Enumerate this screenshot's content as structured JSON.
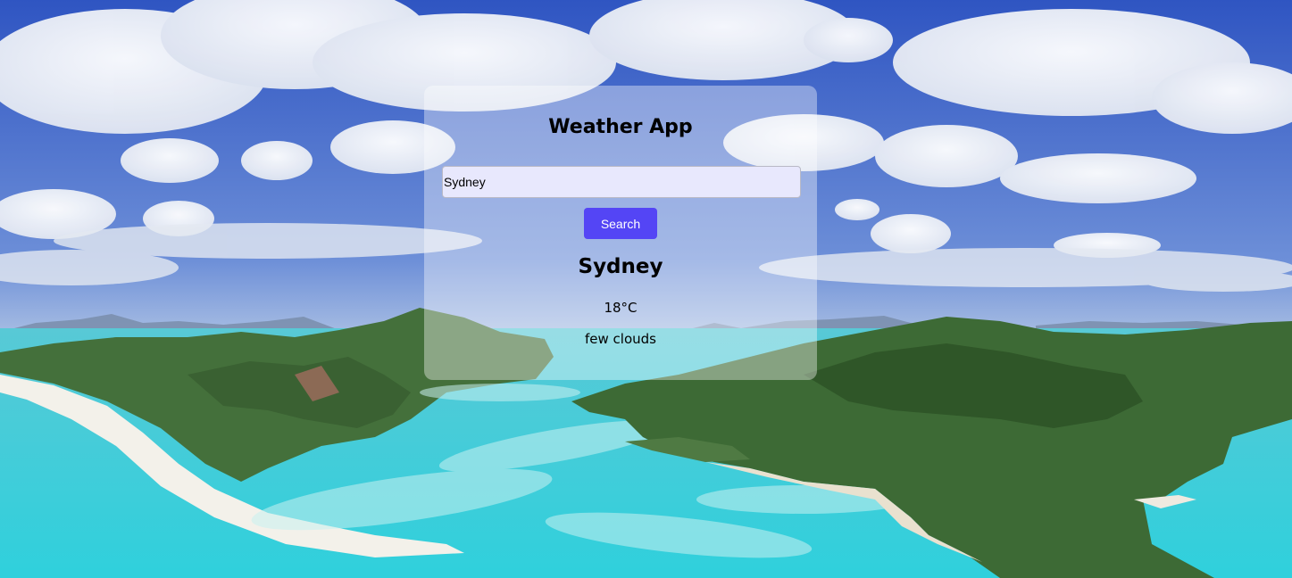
{
  "app": {
    "title": "Weather App"
  },
  "search": {
    "value": "Sydney",
    "button_label": "Search"
  },
  "weather": {
    "city": "Sydney",
    "temperature": "18°C",
    "description": "few clouds"
  },
  "background": {
    "scene": "aerial-coastal-landscape-image",
    "colors": {
      "sky": "#3a63c9",
      "cloud": "#f2f4f8",
      "hills": "#3b6b34",
      "water": "#3fd3dc",
      "sand": "#f3f1ea"
    }
  },
  "theme": {
    "card_background": "rgba(255,255,255,0.38)",
    "input_background": "#e8e8fd",
    "button_color": "#5445f5",
    "button_text": "#ffffff"
  }
}
